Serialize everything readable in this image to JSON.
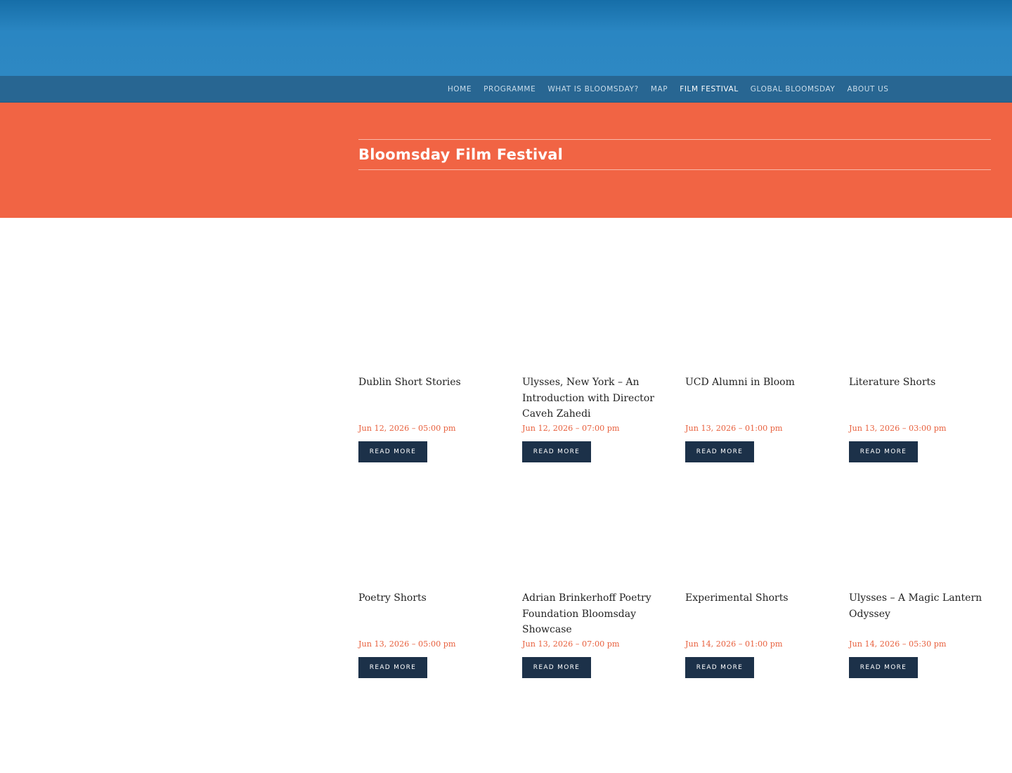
{
  "nav": {
    "items": [
      {
        "label": "HOME",
        "active": false
      },
      {
        "label": "PROGRAMME",
        "active": false
      },
      {
        "label": "WHAT IS BLOOMSDAY?",
        "active": false
      },
      {
        "label": "MAP",
        "active": false
      },
      {
        "label": "FILM FESTIVAL",
        "active": true
      },
      {
        "label": "GLOBAL BLOOMSDAY",
        "active": false
      },
      {
        "label": "ABOUT US",
        "active": false
      }
    ]
  },
  "hero": {
    "title": "Bloomsday Film Festival"
  },
  "events": [
    {
      "title": "Dublin Short Stories",
      "date": "Jun 12, 2026 – 05:00 pm",
      "button": "READ MORE"
    },
    {
      "title": "Ulysses, New York – An Introduction with Director Caveh Zahedi",
      "date": "Jun 12, 2026 – 07:00 pm",
      "button": "READ MORE"
    },
    {
      "title": "UCD Alumni in Bloom",
      "date": "Jun 13, 2026 – 01:00 pm",
      "button": "READ MORE"
    },
    {
      "title": "Literature Shorts",
      "date": "Jun 13, 2026 – 03:00 pm",
      "button": "READ MORE"
    },
    {
      "title": "Poetry Shorts",
      "date": "Jun 13, 2026 – 05:00 pm",
      "button": "READ MORE"
    },
    {
      "title": "Adrian Brinkerhoff Poetry Foundation Bloomsday Showcase",
      "date": "Jun 13, 2026 – 07:00 pm",
      "button": "READ MORE"
    },
    {
      "title": "Experimental Shorts",
      "date": "Jun 14, 2026 – 01:00 pm",
      "button": "READ MORE"
    },
    {
      "title": "Ulysses – A Magic Lantern Odyssey",
      "date": "Jun 14, 2026 – 05:30 pm",
      "button": "READ MORE"
    }
  ],
  "colors": {
    "banner": "#2e88c3",
    "navbar": "#286692",
    "hero": "#f16444",
    "date": "#e8603d",
    "button": "#1c3149"
  }
}
